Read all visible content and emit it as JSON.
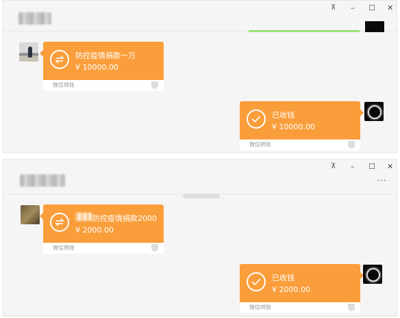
{
  "window_controls": {
    "pin": "⊼",
    "minimize": "–",
    "maximize": "☐",
    "close": "✕",
    "more": "···"
  },
  "icons": {
    "transfer": "transfer-arrows-icon",
    "received": "checkmark-icon",
    "shield": "shield-icon"
  },
  "colors": {
    "card": "#fa9e3b",
    "panel": "#f5f5f5"
  },
  "panel1": {
    "incoming": {
      "title": "防控疫情捐款一万",
      "amount": "¥ 10000.00",
      "source": "微信转账"
    },
    "outgoing": {
      "title": "已收钱",
      "amount": "¥ 10000.00",
      "source": "微信转账"
    }
  },
  "panel2": {
    "incoming": {
      "title": "防控疫情捐款2000",
      "amount": "¥ 2000.00",
      "source": "微信转账"
    },
    "outgoing": {
      "title": "已收钱",
      "amount": "¥ 2000.00",
      "source": "微信转账"
    }
  }
}
